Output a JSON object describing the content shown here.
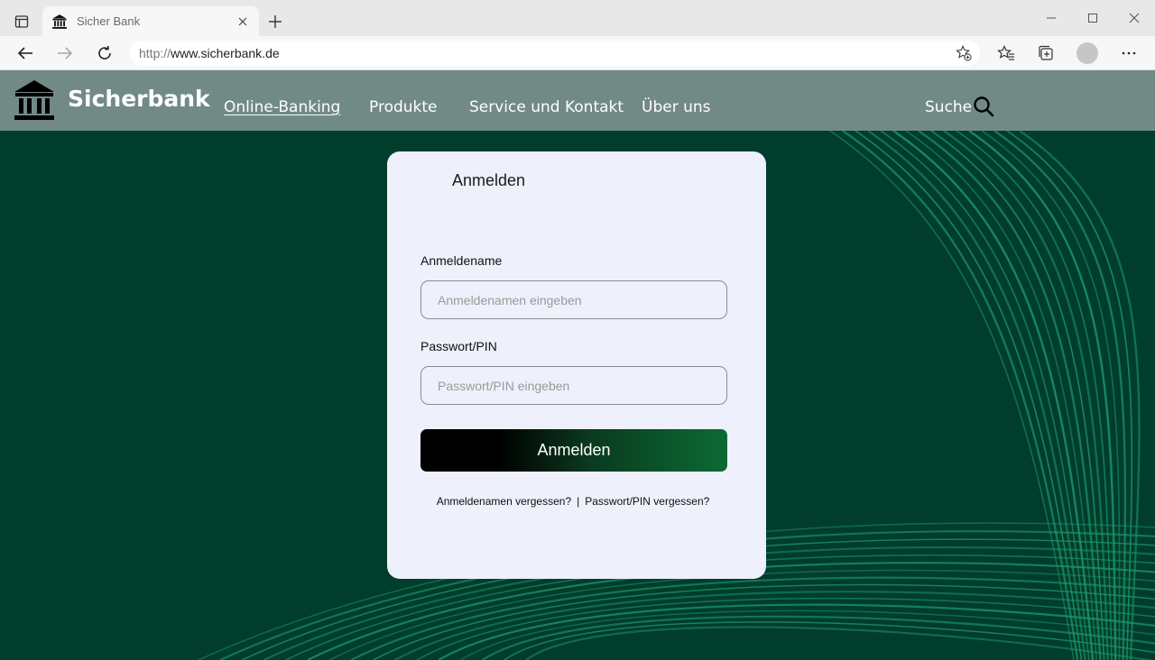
{
  "browser": {
    "tab_title": "Sicher Bank",
    "url_scheme": "http://",
    "url_host": "www.sicherbank.de"
  },
  "site": {
    "brand": "Sicherbank",
    "nav": [
      "Online-Banking",
      "Produkte",
      "Service und Kontakt",
      "Über uns"
    ],
    "active_nav": "Online-Banking",
    "search_label": "Suche"
  },
  "login": {
    "title": "Anmelden",
    "username_label": "Anmeldename",
    "username_placeholder": "Anmeldenamen eingeben",
    "password_label": "Passwort/PIN",
    "password_placeholder": "Passwort/PIN eingeben",
    "submit_label": "Anmelden",
    "forgot_username": "Anmeldenamen vergessen?",
    "separator": "|",
    "forgot_password": "Passwort/PIN vergessen?"
  },
  "colors": {
    "page_background": "#003d2d",
    "header_background": "#728a86",
    "card_background": "#eef0fb",
    "wave_lines": "#1d9a6c"
  },
  "icons": [
    "tab-actions-icon",
    "bank-icon",
    "close-icon",
    "plus-icon",
    "minimize-icon",
    "maximize-icon",
    "back-arrow-icon",
    "forward-arrow-icon",
    "refresh-icon",
    "add-favorite-icon",
    "favorites-icon",
    "collections-icon",
    "more-icon",
    "search-icon"
  ]
}
